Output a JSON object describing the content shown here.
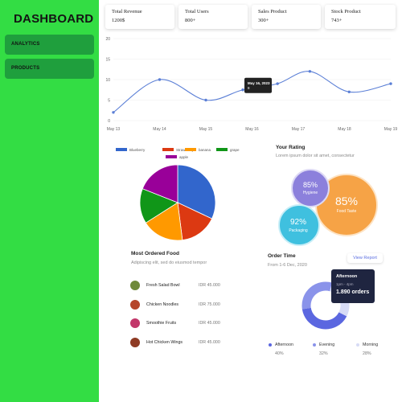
{
  "sidebar": {
    "brand": "DASHBOARD",
    "items": [
      {
        "label": "ANALYTICS"
      },
      {
        "label": "PRODUCTS"
      }
    ]
  },
  "stats": [
    {
      "title": "Total Revenue",
      "value": "1200$"
    },
    {
      "title": "Total Users",
      "value": "800+"
    },
    {
      "title": "Sales Product",
      "value": "300+"
    },
    {
      "title": "Stock Product",
      "value": "743+"
    }
  ],
  "chart_data": [
    {
      "type": "line",
      "categories": [
        "May 13",
        "May 14",
        "May 15",
        "May 16",
        "May 17",
        "May 18",
        "May 19"
      ],
      "x": [
        0,
        1,
        2,
        2.8,
        3.55,
        4.25,
        5.1,
        6
      ],
      "values": [
        2,
        10,
        5,
        7.5,
        9,
        12,
        7,
        9
      ],
      "ylim": [
        0,
        20
      ],
      "yticks": [
        0,
        5,
        10,
        15,
        20
      ],
      "line_color": "#5b7fd6",
      "tooltip": {
        "title": "May 16, 2023",
        "value": "8"
      }
    },
    {
      "type": "pie",
      "labels": [
        "Blueberry",
        "Strawberry",
        "banana",
        "grape",
        "apple"
      ],
      "values": [
        32,
        16,
        18,
        15,
        19
      ],
      "colors": [
        "#3266cc",
        "#dc3912",
        "#ff9900",
        "#109618",
        "#990099"
      ]
    }
  ],
  "rating": {
    "title": "Your Rating",
    "subtitle": "Lorem ipsum dolor sit amet, consectetur",
    "bubbles": [
      {
        "value": "85%",
        "label": "Hygiene",
        "color": "#8c80dc"
      },
      {
        "value": "85%",
        "label": "Food Taste",
        "color": "#f6a346"
      },
      {
        "value": "92%",
        "label": "Packaging",
        "color": "#3fc0df"
      }
    ]
  },
  "most_ordered": {
    "title": "Most Ordered Food",
    "subtitle": "Adipiscing elit, sed do eiusmod tempor",
    "items": [
      {
        "name": "Fresh Salad Bowl",
        "price": "IDR 45.000",
        "color": "#6f8a3a"
      },
      {
        "name": "Chicken Noodles",
        "price": "IDR 75.000",
        "color": "#b5452a"
      },
      {
        "name": "Smoothie Fruits",
        "price": "IDR 45.000",
        "color": "#c2376a"
      },
      {
        "name": "Hot Chicken Wings",
        "price": "IDR 45.000",
        "color": "#8e3b24"
      }
    ]
  },
  "order_time": {
    "title": "Order Time",
    "subtitle": "From 1-6 Dec, 2020",
    "button": "View Report",
    "tooltip": {
      "title": "Afternoon",
      "time": "1pm - 4pm",
      "value": "1.890 orders"
    },
    "segments": [
      {
        "label": "Afternoon",
        "percent": "40%",
        "fraction": 0.4,
        "color": "#5b67e0"
      },
      {
        "label": "Evening",
        "percent": "32%",
        "fraction": 0.32,
        "color": "#8a93ea"
      },
      {
        "label": "Morning",
        "percent": "28%",
        "fraction": 0.28,
        "color": "#d7dbf6"
      }
    ]
  }
}
